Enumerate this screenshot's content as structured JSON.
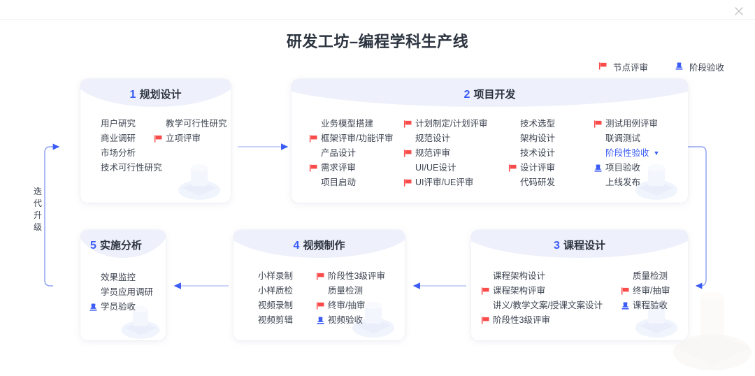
{
  "window": {
    "close_icon": "close-icon"
  },
  "header": {
    "title": "研发工坊–编程学科生产线"
  },
  "legend": [
    {
      "icon": "flag-icon",
      "label": "节点评审",
      "color": "#fa4b4b"
    },
    {
      "icon": "stamp-icon",
      "label": "阶段验收",
      "color": "#3b5cf5"
    }
  ],
  "loop_label": "迭代升级",
  "colors": {
    "accent": "#3b5cf5",
    "flag": "#fa4b4b",
    "header_band": "#eef0fb",
    "text": "#3d4451",
    "title": "#2c3440"
  },
  "stages": [
    {
      "num": "1",
      "title": "规划设计",
      "title_align": "center",
      "columns": [
        {
          "items": [
            {
              "label": "用户研究",
              "icon": "none"
            },
            {
              "label": "商业调研",
              "icon": "none"
            },
            {
              "label": "市场分析",
              "icon": "none"
            },
            {
              "label": "技术可行性研究",
              "icon": "none"
            }
          ]
        },
        {
          "items": [
            {
              "label": "教学可行性研究",
              "icon": "none"
            },
            {
              "label": "立项评审",
              "icon": "flag-icon"
            }
          ]
        }
      ]
    },
    {
      "num": "2",
      "title": "项目开发",
      "title_align": "center",
      "columns": [
        {
          "items": [
            {
              "label": "业务模型搭建",
              "icon": "none"
            },
            {
              "label": "框架评审/功能评审",
              "icon": "flag-icon"
            },
            {
              "label": "产品设计",
              "icon": "none"
            },
            {
              "label": "需求评审",
              "icon": "flag-icon"
            },
            {
              "label": "项目启动",
              "icon": "none"
            }
          ]
        },
        {
          "items": [
            {
              "label": "计划制定/计划评审",
              "icon": "flag-icon"
            },
            {
              "label": "规范设计",
              "icon": "none"
            },
            {
              "label": "规范评审",
              "icon": "flag-icon"
            },
            {
              "label": "UI/UE设计",
              "icon": "none"
            },
            {
              "label": "UI评审/UE评审",
              "icon": "flag-icon"
            }
          ]
        },
        {
          "items": [
            {
              "label": "技术选型",
              "icon": "none"
            },
            {
              "label": "架构设计",
              "icon": "none"
            },
            {
              "label": "技术设计",
              "icon": "none"
            },
            {
              "label": "设计评审",
              "icon": "flag-icon"
            },
            {
              "label": "代码研发",
              "icon": "none"
            }
          ]
        },
        {
          "items": [
            {
              "label": "测试用例评审",
              "icon": "flag-icon"
            },
            {
              "label": "联调测试",
              "icon": "none"
            },
            {
              "label": "阶段性验收",
              "icon": "none",
              "style": "dropdown"
            },
            {
              "label": "项目验收",
              "icon": "stamp-icon"
            },
            {
              "label": "上线发布",
              "icon": "none"
            }
          ]
        }
      ]
    },
    {
      "num": "3",
      "title": "课程设计",
      "title_align": "center",
      "columns": [
        {
          "items": [
            {
              "label": "课程架构设计",
              "icon": "none"
            },
            {
              "label": "课程架构评审",
              "icon": "flag-icon"
            },
            {
              "label": "讲义/教学文案/授课文案设计",
              "icon": "none"
            },
            {
              "label": "阶段性3级评审",
              "icon": "flag-icon"
            }
          ]
        },
        {
          "items": [
            {
              "label": "质量检测",
              "icon": "none"
            },
            {
              "label": "终审/抽审",
              "icon": "flag-icon"
            },
            {
              "label": "课程验收",
              "icon": "stamp-icon"
            }
          ]
        }
      ]
    },
    {
      "num": "4",
      "title": "视频制作",
      "title_align": "center",
      "columns": [
        {
          "items": [
            {
              "label": "小样录制",
              "icon": "none"
            },
            {
              "label": "小样质检",
              "icon": "none"
            },
            {
              "label": "视频录制",
              "icon": "none"
            },
            {
              "label": "视频剪辑",
              "icon": "none"
            }
          ]
        },
        {
          "items": [
            {
              "label": "阶段性3级评审",
              "icon": "flag-icon"
            },
            {
              "label": "质量检测",
              "icon": "none"
            },
            {
              "label": "终审/抽审",
              "icon": "flag-icon"
            },
            {
              "label": "视频验收",
              "icon": "stamp-icon"
            }
          ]
        }
      ]
    },
    {
      "num": "5",
      "title": "实施分析",
      "title_align": "left",
      "columns": [
        {
          "items": [
            {
              "label": "效果监控",
              "icon": "none"
            },
            {
              "label": "学员应用调研",
              "icon": "none"
            },
            {
              "label": "学员验收",
              "icon": "stamp-icon"
            }
          ]
        }
      ]
    }
  ]
}
